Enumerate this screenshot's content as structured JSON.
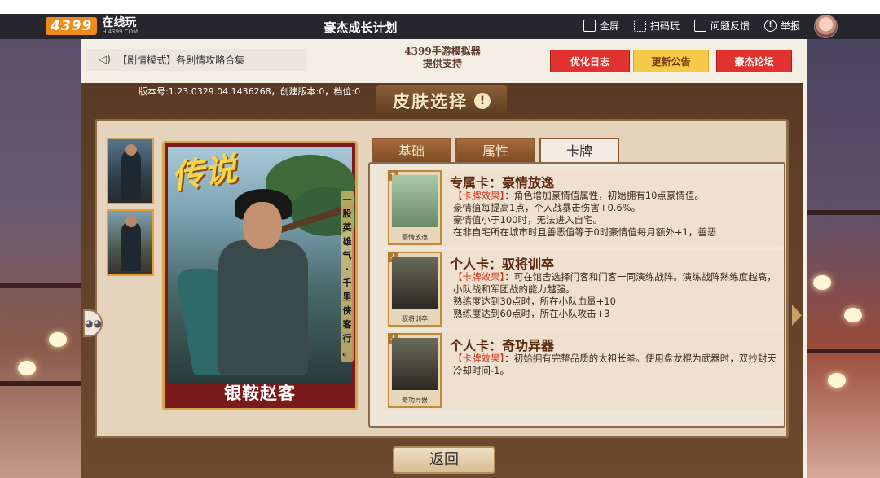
{
  "header": {
    "logo_brand": "4399",
    "logo_main": "在线玩",
    "logo_sub": "H.4399.COM",
    "title": "豪杰成长计划",
    "actions": [
      {
        "label": "全屏",
        "icon": "fullscreen-icon"
      },
      {
        "label": "扫码玩",
        "icon": "qrcode-icon"
      },
      {
        "label": "问题反馈",
        "icon": "feedback-icon"
      },
      {
        "label": "举报",
        "icon": "report-icon"
      }
    ]
  },
  "toolbar": {
    "notice": "【剧情模式】各剧情攻略合集",
    "support_line1": "4399手游模拟器",
    "support_line2": "提供支持",
    "btn_optimize": "优化日志",
    "btn_update": "更新公告",
    "btn_forum": "豪杰论坛"
  },
  "panel": {
    "version": "版本号:1.23.0329.04.1436268，创建版本:0，档位:0",
    "title": "皮肤选择",
    "warn_symbol": "!",
    "back_label": "返回"
  },
  "card": {
    "rarity": "传说",
    "motto_chars": [
      "一",
      "股",
      "英",
      "雄",
      "气",
      "·",
      "千",
      "里",
      "侠",
      "客",
      "行",
      "。"
    ],
    "name": "银鞍赵客"
  },
  "tabs": [
    "基础",
    "属性",
    "卡牌"
  ],
  "active_tab": "卡牌",
  "entries": [
    {
      "title": "专属卡：豪情放逸",
      "mini_label": "豪情放逸",
      "effect_tag": "【卡牌效果】",
      "first_line": "：角色增加豪情值属性，初始拥有10点豪情值。",
      "lines": [
        "豪情值每提高1点，个人战暴击伤害+0.6%。",
        "豪情值小于100时，无法进入自宅。",
        "在非自宅所在城市时且善恶值等于0时豪情值每月额外+1，善恶"
      ]
    },
    {
      "title": "个人卡：驭将训卒",
      "mini_label": "驭将训卒",
      "effect_tag": "【卡牌效果】",
      "first_line": "：可在馆舍选择门客和门客一同演练战阵。演练战阵熟练度越高，小队战和军团战的能力越强。",
      "lines": [
        "熟练度达到30点时，所在小队血量+10",
        "熟练度达到60点时，所在小队攻击+3"
      ]
    },
    {
      "title": "个人卡：奇功异器",
      "mini_label": "奇功异器",
      "effect_tag": "【卡牌效果】",
      "first_line": "：初始拥有完整品质的太祖长拳。使用盘龙棍为武器时，双抄封天冷却时间-1。",
      "lines": []
    }
  ],
  "colors": {
    "header_bg": "#26262c",
    "logo_orange": "#f08a1c",
    "link_red": "#e2322f",
    "link_yellow": "#f7c948",
    "effect_red": "#d0321a"
  }
}
